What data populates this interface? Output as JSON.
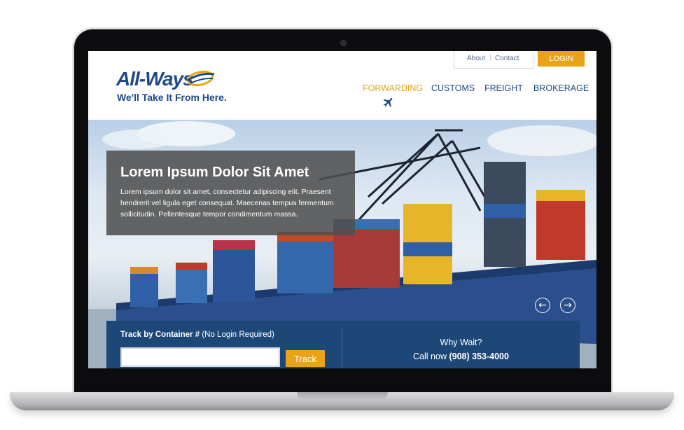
{
  "brand": {
    "name": "All-Ways",
    "tagline": "We'll Take It From Here.",
    "primary_color": "#1f4a86",
    "accent_color": "#e8a318"
  },
  "utility_nav": {
    "about": "About",
    "separator": "|",
    "contact": "Contact",
    "login": "LOGIN"
  },
  "main_nav": [
    {
      "label": "FORWARDING",
      "active": true,
      "icon": "plane-icon"
    },
    {
      "label": "CUSTOMS",
      "active": false
    },
    {
      "label": "FREIGHT",
      "active": false
    },
    {
      "label": "BROKERAGE",
      "active": false
    }
  ],
  "hero": {
    "title": "Lorem Ipsum Dolor Sit Amet",
    "body": "Lorem ipsum dolor sit amet, consectetur adipiscing elit. Praesent hendrerit vel ligula eget consequat. Maecenas tempus fermentum sollicitudin. Pellentesque tempor condimentum massa.",
    "prev_icon": "arrow-left-icon",
    "next_icon": "arrow-right-icon",
    "prev_glyph": "←",
    "next_glyph": "→"
  },
  "tracking": {
    "label_bold": "Track by Container #",
    "label_note": " (No Login Required)",
    "input_value": "",
    "button": "Track"
  },
  "callout": {
    "title": "Why Wait?",
    "phone_prefix": "Call now ",
    "phone": "(908) 353-4000"
  }
}
